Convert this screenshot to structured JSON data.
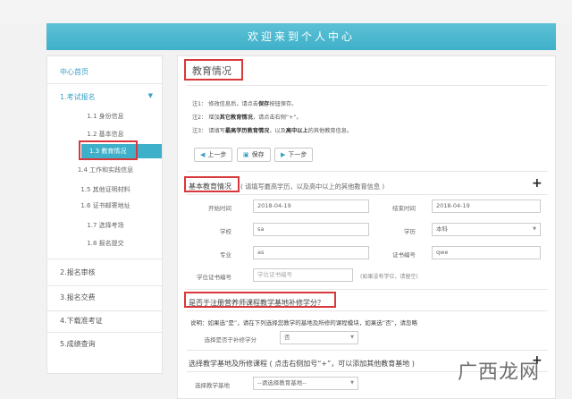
{
  "banner": {
    "title": "欢迎来到个人中心"
  },
  "sidebar": {
    "home": "中心首页",
    "sections": [
      {
        "label": "1.考试报名",
        "caret": "▼"
      },
      {
        "label": "2.报名审核"
      },
      {
        "label": "3.报名交费"
      },
      {
        "label": "4.下载准考证"
      },
      {
        "label": "5.成绩查询"
      }
    ],
    "subitems": [
      "1.1 身份信息",
      "1.2 基本信息",
      "1.3 教育情况",
      "1.4 工作和实践信息",
      "1.5 其他证明材料",
      "1.6 证书邮寄地址",
      "1.7 选择考场",
      "1.8 报名提交"
    ]
  },
  "main": {
    "title": "教育情况",
    "notes": [
      {
        "prefix": "注1：",
        "a": "修改信息后，请点击",
        "bold": "保存",
        "b": "按钮保存。"
      },
      {
        "prefix": "注2：",
        "a": "增加",
        "bold": "其它教育情况",
        "b": "，请点击右侧“+”。"
      },
      {
        "prefix": "注3：",
        "a": "请填写",
        "bold": "最高学历教育情况",
        "b": "，以及",
        "bold2": "高中以上",
        "c": "的其他教育信息。"
      }
    ],
    "buttons": {
      "prev": "上一步",
      "save": "保存",
      "next": "下一步"
    },
    "basic": {
      "title": "基本教育情况",
      "hint": "( 请填写最高学历，以及高中以上的其他教育信息 )",
      "plus": "+",
      "fields": {
        "start_label": "开始时间",
        "start_value": "2018-04-19",
        "end_label": "结束时间",
        "end_value": "2018-04-19",
        "school_label": "学校",
        "school_value": "sa",
        "edu_label": "学历",
        "edu_value": "本科",
        "major_label": "专业",
        "major_value": "as",
        "certno_label": "证书编号",
        "certno_value": "qwe",
        "degree_label": "学位证书编号",
        "degree_placeholder": "学位证书编号",
        "degree_hint": "(如果没有学位，请留空)"
      }
    },
    "base": {
      "title": "是否于注册营养师课程教学基地补修学分？",
      "desc": "说明：如果选“是”，请在下列选择您教学的基地及所修的课程模块，如果选“否”，请忽略",
      "select_label": "选择是否于补修学分",
      "select_value": "否",
      "course_title": "选择教学基地及所修课程 ( 点击右侧加号“+”，可以添加其他教育基地 )",
      "plus": "+",
      "base_label": "选择教学基地",
      "base_value": "--请选择教育基地--"
    }
  },
  "watermark": "广西龙网"
}
